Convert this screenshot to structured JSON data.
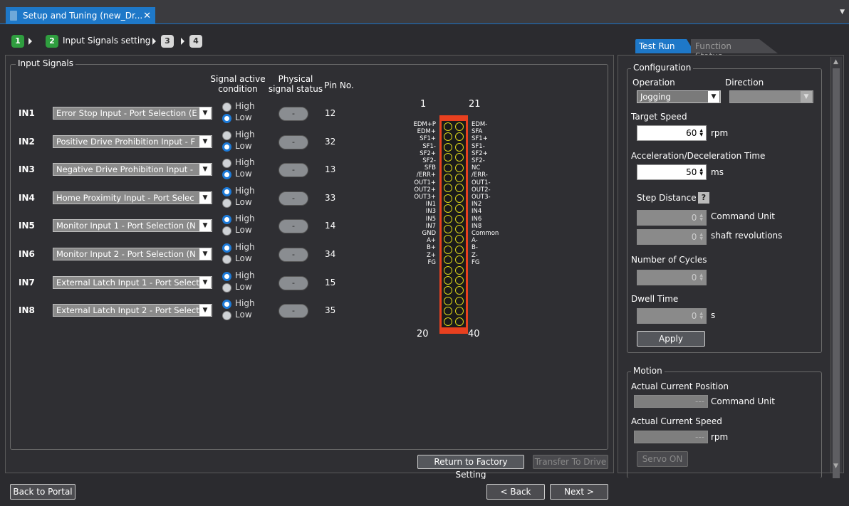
{
  "window": {
    "tab_title": "Setup and Tuning (new_Dr...",
    "close_glyph": "✕"
  },
  "wizard": {
    "steps": [
      "1",
      "2",
      "3",
      "4"
    ],
    "current_label": "Input Signals setting"
  },
  "input_signals": {
    "title": "Input Signals",
    "col_condition": "Signal active condition",
    "col_condition_l1": "Signal active",
    "col_condition_l2": "condition",
    "col_physical_l1": "Physical",
    "col_physical_l2": "signal status",
    "col_pin": "Pin No.",
    "high_label": "High",
    "low_label": "Low",
    "rows": [
      {
        "id": "IN1",
        "func": "Error Stop Input - Port Selection (E",
        "active": "Low",
        "status": "-",
        "pin": "12"
      },
      {
        "id": "IN2",
        "func": "Positive Drive Prohibition Input - F",
        "active": "Low",
        "status": "-",
        "pin": "32"
      },
      {
        "id": "IN3",
        "func": "Negative Drive Prohibition Input - ",
        "active": "Low",
        "status": "-",
        "pin": "13"
      },
      {
        "id": "IN4",
        "func": "Home Proximity Input - Port Selec",
        "active": "High",
        "status": "-",
        "pin": "33"
      },
      {
        "id": "IN5",
        "func": "Monitor Input 1 - Port Selection (N",
        "active": "High",
        "status": "-",
        "pin": "14"
      },
      {
        "id": "IN6",
        "func": "Monitor Input 2 - Port Selection (N",
        "active": "High",
        "status": "-",
        "pin": "34"
      },
      {
        "id": "IN7",
        "func": "External Latch Input 1 - Port Select",
        "active": "High",
        "status": "-",
        "pin": "15"
      },
      {
        "id": "IN8",
        "func": "External Latch Input 2 - Port Select",
        "active": "High",
        "status": "-",
        "pin": "35"
      }
    ]
  },
  "connector": {
    "top_left": "1",
    "top_right": "21",
    "bottom_left": "20",
    "bottom_right": "40",
    "left_pins": [
      "EDM+P",
      "EDM+",
      "SF1+",
      "SF1-",
      "SF2+",
      "SF2-",
      "SFB",
      "/ERR+",
      "OUT1+",
      "OUT2+",
      "OUT3+",
      "IN1",
      "IN3",
      "IN5",
      "IN7",
      "GND",
      "A+",
      "B+",
      "Z+",
      "FG"
    ],
    "right_pins": [
      "EDM-",
      "SFA",
      "SF1+",
      "SF1-",
      "SF2+",
      "SF2-",
      "NC",
      "/ERR-",
      "OUT1-",
      "OUT2-",
      "OUT3-",
      "IN2",
      "IN4",
      "IN6",
      "IN8",
      "Common",
      "A-",
      "B-",
      "Z-",
      "FG"
    ],
    "body_color": "#e8401f",
    "hole_color": "#d9d41a"
  },
  "buttons": {
    "factory": "Return to Factory Setting",
    "transfer": "Transfer To Drive",
    "back_portal": "Back to Portal",
    "back": "< Back",
    "next": "Next >"
  },
  "right": {
    "tabs": [
      "Test Run",
      "Function Status"
    ],
    "config": {
      "title": "Configuration",
      "operation_label": "Operation",
      "operation_value": "Jogging",
      "direction_label": "Direction",
      "direction_value": "",
      "target_speed_label": "Target Speed",
      "target_speed": "60",
      "target_speed_unit": "rpm",
      "accel_label": "Acceleration/Deceleration Time",
      "accel": "50",
      "accel_unit": "ms",
      "step_label": "Step Distance",
      "step_help": "?",
      "step_value1": "0",
      "step_unit1": "Command Unit",
      "step_value2": "0",
      "step_unit2": "shaft revolutions",
      "cycles_label": "Number of Cycles",
      "cycles": "0",
      "dwell_label": "Dwell Time",
      "dwell": "0",
      "dwell_unit": "s",
      "apply": "Apply"
    },
    "motion": {
      "title": "Motion",
      "pos_label": "Actual Current Position",
      "pos_value": "---",
      "pos_unit": "Command Unit",
      "speed_label": "Actual Current Speed",
      "speed_value": "---",
      "speed_unit": "rpm",
      "servo": "Servo ON"
    }
  },
  "colors": {
    "accent": "#1e78c8",
    "step_green": "#2f9e3f",
    "connector": "#e8401f"
  }
}
